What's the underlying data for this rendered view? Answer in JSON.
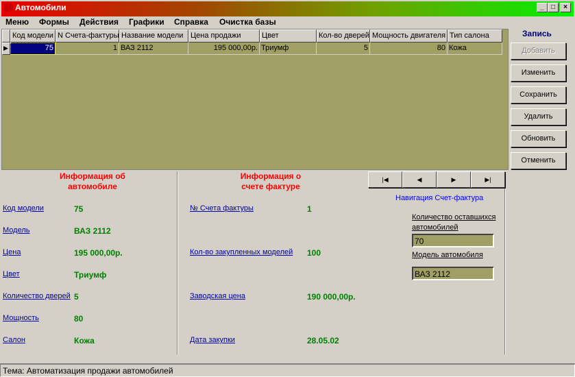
{
  "window": {
    "title": "Автомобили"
  },
  "menu": [
    "Меню",
    "Формы",
    "Действия",
    "Графики",
    "Справка",
    "Очистка базы"
  ],
  "grid": {
    "columns": [
      "Код модели",
      "N Счета-фактуры",
      "Название модели",
      "Цена продажи",
      "Цвет",
      "Кол-во дверей",
      "Мощность двигателя",
      "Тип салона"
    ],
    "rows": [
      [
        "75",
        "1",
        "ВАЗ 2112",
        "195 000,00р.",
        "Триумф",
        "5",
        "80",
        "Кожа"
      ]
    ]
  },
  "record_panel": {
    "title": "Запись",
    "buttons": [
      "Добавить",
      "Изменить",
      "Сохранить",
      "Удалить",
      "Обновить",
      "Отменить"
    ]
  },
  "car_info": {
    "title_line1": "Информация об",
    "title_line2": "автомобиле",
    "fields": [
      {
        "label": "Код модели",
        "value": "75"
      },
      {
        "label": "Модель",
        "value": "ВАЗ 2112"
      },
      {
        "label": "Цена",
        "value": "195 000,00р."
      },
      {
        "label": "Цвет",
        "value": "Триумф"
      },
      {
        "label": "Количество дверей",
        "value": "5"
      },
      {
        "label": "Мощность",
        "value": "80"
      },
      {
        "label": "Салон",
        "value": "Кожа"
      }
    ]
  },
  "invoice_info": {
    "title_line1": "Информация о",
    "title_line2": "счете фактуре",
    "fields": [
      {
        "label": "№ Счета фактуры",
        "value": "1"
      },
      {
        "label": "Кол-во закупленных моделей",
        "value": "100"
      },
      {
        "label": "Заводская цена",
        "value": "190 000,00р."
      },
      {
        "label": "Дата закупки",
        "value": "28.05.02"
      }
    ]
  },
  "navigation": {
    "label": "Навигация Счет-фактура",
    "remaining_label_1": "Количество оставшихся",
    "remaining_label_2": "автомобилей",
    "remaining_value": "70",
    "model_label": "Модель автомобиля",
    "model_value": "ВАЗ 2112"
  },
  "status": "Тема: Автоматизация продажи автомобилей"
}
